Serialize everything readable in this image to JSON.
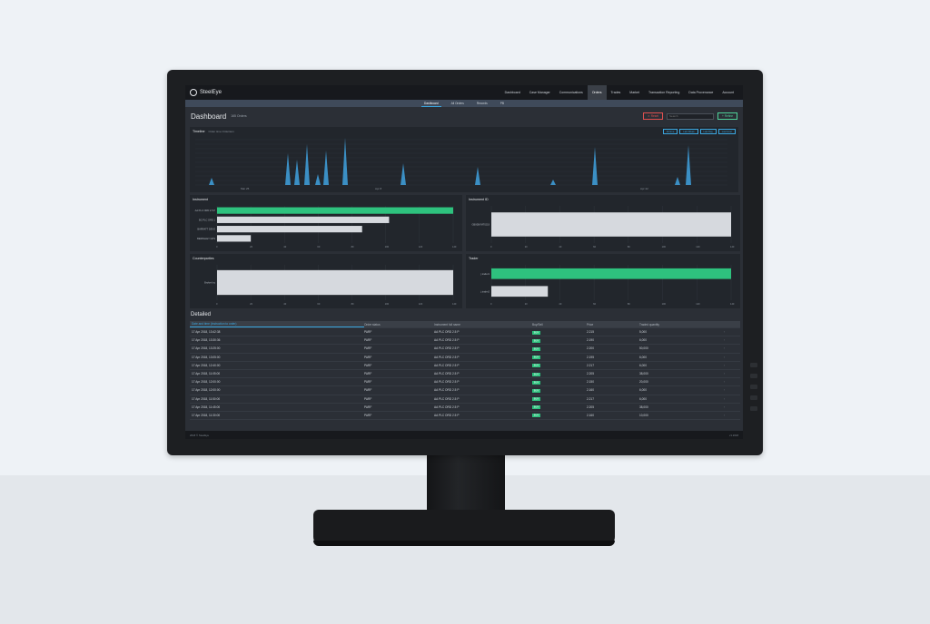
{
  "app": {
    "brand": "SteelEye"
  },
  "nav": {
    "items": [
      "Dashboard",
      "Case Manager",
      "Communications",
      "Orders",
      "Trades",
      "Market",
      "Transaction Reporting",
      "Data Provenance",
      "Account"
    ],
    "active_index": 3
  },
  "subnav": {
    "tabs": [
      "Dashboard",
      "All Orders",
      "Records",
      "PB"
    ],
    "active_index": 0
  },
  "header": {
    "title": "Dashboard",
    "subtitle": "165 Orders",
    "reset_label": "Reset",
    "search_placeholder": "Search",
    "refine_label": "Refine"
  },
  "timeline": {
    "title": "Timeline",
    "subtitle": "Order time Orderitem",
    "buttons": [
      "All time",
      "Last Week",
      "Last Day",
      "Last Hour"
    ],
    "x_ticks": [
      "Mar 25",
      "Apr 8",
      "Apr 22"
    ]
  },
  "instrument": {
    "title": "Instrument",
    "labels": [
      "AA PLC ORD 2.5 P",
      "BC PLC ORD 1",
      "BARRATT DEVS",
      "BERKELEY GPS"
    ],
    "values": [
      143,
      102,
      86,
      20
    ],
    "x_ticks": [
      "0",
      "20",
      "40",
      "60",
      "80",
      "100",
      "120",
      "140"
    ]
  },
  "instrument_id": {
    "title": "Instrument ID",
    "labels": [
      "GB00BYMT0J19"
    ],
    "values": [
      143
    ],
    "x_ticks": [
      "0",
      "20",
      "40",
      "60",
      "80",
      "100",
      "120",
      "140"
    ]
  },
  "counterparties": {
    "title": "Counterparties",
    "labels": [
      "Broker Inc"
    ],
    "values": [
      143
    ],
    "x_ticks": [
      "0",
      "20",
      "40",
      "60",
      "80",
      "100",
      "120",
      "140"
    ]
  },
  "trader": {
    "title": "Trader",
    "labels": [
      "j.trader1",
      "j.trader2"
    ],
    "values": [
      143,
      33
    ],
    "x_ticks": [
      "0",
      "20",
      "40",
      "60",
      "80",
      "100",
      "120",
      "140"
    ]
  },
  "detailed": {
    "title": "Detailed",
    "columns": [
      "Date and time (Instruction to order)",
      "Order status",
      "Instrument full name",
      "Buy/Sell",
      "Price",
      "Traded quantity"
    ],
    "rows": [
      [
        "17 Apr 2018, 13:42:38",
        "PARF",
        "AA PLC ORD 2.5 P",
        "BUY",
        "2.215",
        "5,000"
      ],
      [
        "17 Apr 2018, 13:30:36",
        "PARF",
        "AA PLC ORD 2.5 P",
        "BUY",
        "2.190",
        "6,000"
      ],
      [
        "17 Apr 2018, 13:25:00",
        "PARF",
        "AA PLC ORD 2.5 P",
        "BUY",
        "2.200",
        "50,000"
      ],
      [
        "17 Apr 2018, 13:05:00",
        "PARF",
        "AA PLC ORD 2.5 P",
        "BUY",
        "2.195",
        "6,000"
      ],
      [
        "17 Apr 2018, 12:40:00",
        "PARF",
        "AA PLC ORD 2.5 P",
        "BUY",
        "2.217",
        "6,000"
      ],
      [
        "17 Apr 2018, 11:05:00",
        "PARF",
        "AA PLC ORD 2.5 P",
        "BUY",
        "2.205",
        "38,000"
      ],
      [
        "17 Apr 2018, 12:00:00",
        "PARF",
        "AA PLC ORD 2.5 P",
        "BUY",
        "2.150",
        "20,000"
      ],
      [
        "17 Apr 2018, 12:00:00",
        "PARF",
        "AA PLC ORD 2.5 P",
        "BUY",
        "2.160",
        "6,000"
      ],
      [
        "17 Apr 2018, 11:50:00",
        "PARF",
        "AA PLC ORD 2.5 P",
        "BUY",
        "2.217",
        "6,000"
      ],
      [
        "17 Apr 2018, 11:45:00",
        "PARF",
        "AA PLC ORD 2.5 P",
        "BUY",
        "2.205",
        "38,000"
      ],
      [
        "17 Apr 2018, 11:30:00",
        "PARF",
        "AA PLC ORD 2.5 P",
        "BUY",
        "2.160",
        "10,000"
      ]
    ]
  },
  "footer": {
    "left": "2018 © SteelEye",
    "right": "v1.2018"
  },
  "colors": {
    "accent": "#3ba7e0",
    "bar_primary": "#2ec27e",
    "bar_secondary": "#d6d9de",
    "spike": "#3b8fc4"
  },
  "chart_data": [
    {
      "type": "area",
      "title": "Timeline",
      "x": [
        "Mar 25",
        "Apr 8",
        "Apr 22"
      ],
      "ylim": [
        0,
        10
      ]
    },
    {
      "type": "bar",
      "title": "Instrument",
      "categories": [
        "AA PLC ORD 2.5 P",
        "BC PLC ORD 1",
        "BARRATT DEVS",
        "BERKELEY GPS"
      ],
      "values": [
        143,
        102,
        86,
        20
      ],
      "xlim": [
        0,
        140
      ]
    },
    {
      "type": "bar",
      "title": "Instrument ID",
      "categories": [
        "GB00BYMT0J19"
      ],
      "values": [
        143
      ],
      "xlim": [
        0,
        140
      ]
    },
    {
      "type": "bar",
      "title": "Counterparties",
      "categories": [
        "Broker Inc"
      ],
      "values": [
        143
      ],
      "xlim": [
        0,
        140
      ]
    },
    {
      "type": "bar",
      "title": "Trader",
      "categories": [
        "j.trader1",
        "j.trader2"
      ],
      "values": [
        143,
        33
      ],
      "xlim": [
        0,
        140
      ]
    }
  ]
}
